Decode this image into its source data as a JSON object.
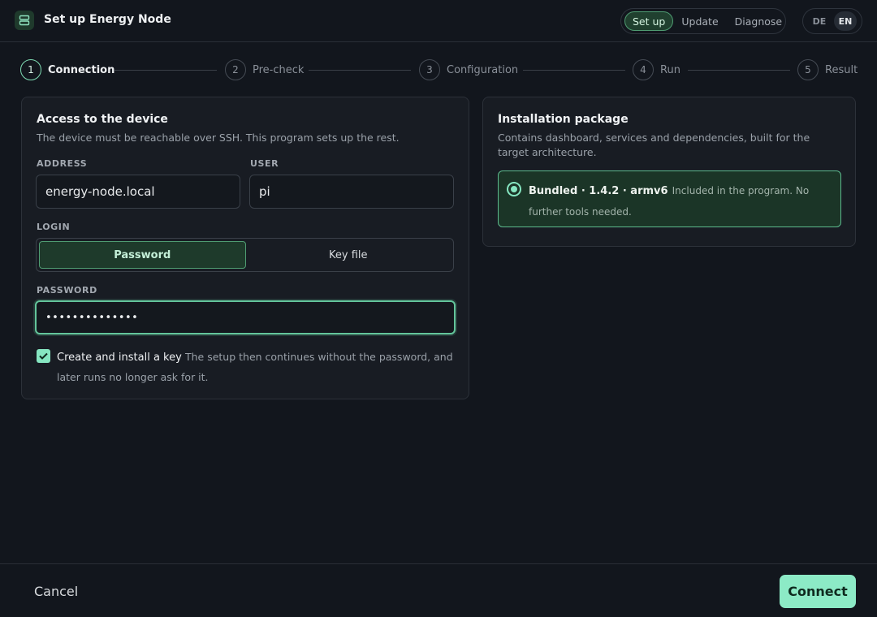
{
  "header": {
    "title": "Set up Energy Node",
    "modes": [
      {
        "label": "Set up",
        "active": true
      },
      {
        "label": "Update",
        "active": false
      },
      {
        "label": "Diagnose",
        "active": false
      }
    ],
    "languages": [
      {
        "label": "DE",
        "active": false
      },
      {
        "label": "EN",
        "active": true
      }
    ]
  },
  "stepper": {
    "steps": [
      {
        "number": "1",
        "label": "Connection",
        "active": true
      },
      {
        "number": "2",
        "label": "Pre-check",
        "active": false
      },
      {
        "number": "3",
        "label": "Configuration",
        "active": false
      },
      {
        "number": "4",
        "label": "Run",
        "active": false
      },
      {
        "number": "5",
        "label": "Result",
        "active": false
      }
    ]
  },
  "access": {
    "title": "Access to the device",
    "description": "The device must be reachable over SSH. This program sets up the rest.",
    "address_label": "ADDRESS",
    "address_value": "energy-node.local",
    "user_label": "USER",
    "user_value": "pi",
    "login_label": "LOGIN",
    "login_options": [
      {
        "label": "Password",
        "active": true
      },
      {
        "label": "Key file",
        "active": false
      }
    ],
    "password_label": "PASSWORD",
    "password_value": "••••••••••••••",
    "checkbox_label": "Create and install a key",
    "checkbox_hint": "The setup then continues without the password, and later runs no longer ask for it.",
    "checkbox_checked": true
  },
  "package": {
    "title": "Installation package",
    "description": "Contains dashboard, services and dependencies, built for the target architecture.",
    "option_name": "Bundled · 1.4.2 · armv6",
    "option_desc": "Included in the program. No further tools needed.",
    "selected": true
  },
  "footer": {
    "cancel_label": "Cancel",
    "connect_label": "Connect"
  },
  "colors": {
    "accent": "#86e6c1",
    "background": "#12161d",
    "card": "#181c23"
  }
}
